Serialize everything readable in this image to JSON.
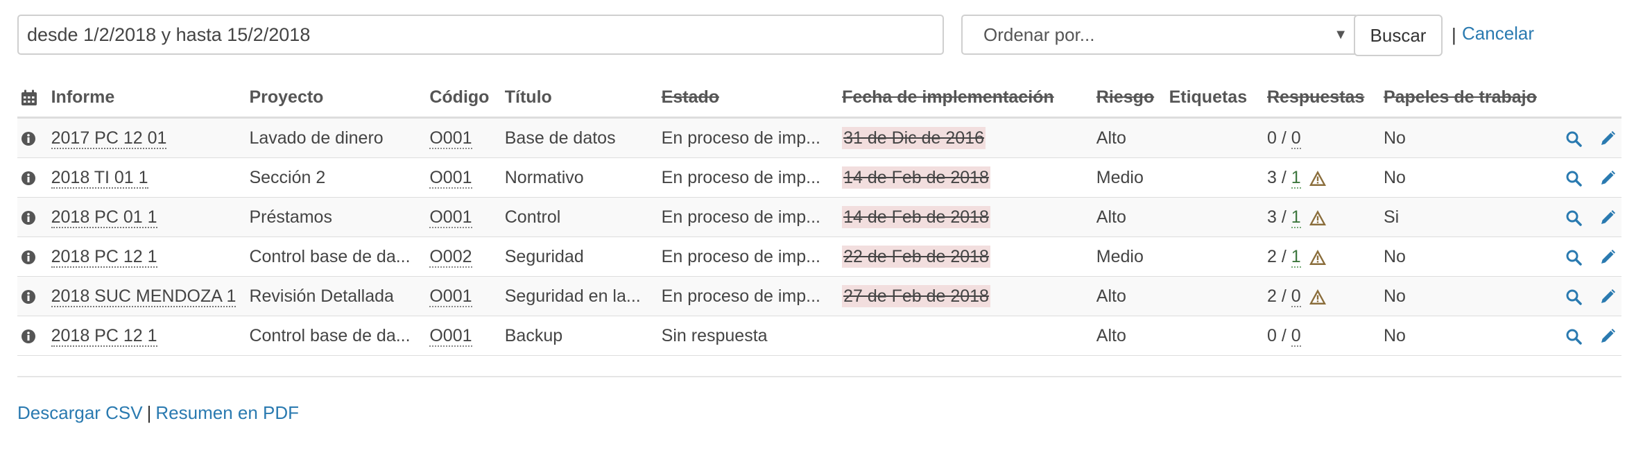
{
  "filter": {
    "query_value": "desde 1/2/2018 y hasta 15/2/2018",
    "order_placeholder": "Ordenar por...",
    "search_label": "Buscar",
    "separator": "|",
    "cancel_label": "Cancelar"
  },
  "table": {
    "headers": {
      "informe": "Informe",
      "proyecto": "Proyecto",
      "codigo": "Código",
      "titulo": "Título",
      "estado": "Estado",
      "fecha": "Fecha de implementación",
      "riesgo": "Riesgo",
      "etiquetas": "Etiquetas",
      "respuestas": "Respuestas",
      "papeles": "Papeles de trabajo"
    },
    "rows": [
      {
        "informe": "2017 PC 12 01",
        "proyecto": "Lavado de dinero",
        "codigo": "O001",
        "titulo": "Base de datos",
        "estado": "En proceso de imp...",
        "fecha": "31 de Dic de 2016",
        "riesgo": "Alto",
        "resp_a": "0",
        "resp_sep": " / ",
        "resp_b": "0",
        "papeles": "No"
      },
      {
        "informe": "2018 TI 01 1",
        "proyecto": "Sección 2",
        "codigo": "O001",
        "titulo": "Normativo",
        "estado": "En proceso de imp...",
        "fecha": "14 de Feb de 2018",
        "riesgo": "Medio",
        "resp_a": "3",
        "resp_sep": " / ",
        "resp_b": "1",
        "papeles": "No"
      },
      {
        "informe": "2018 PC 01 1",
        "proyecto": "Préstamos",
        "codigo": "O001",
        "titulo": "Control",
        "estado": "En proceso de imp...",
        "fecha": "14 de Feb de 2018",
        "riesgo": "Alto",
        "resp_a": "3",
        "resp_sep": " / ",
        "resp_b": "1",
        "papeles": "Si"
      },
      {
        "informe": "2018 PC 12 1",
        "proyecto": "Control base de da...",
        "codigo": "O002",
        "titulo": "Seguridad",
        "estado": "En proceso de imp...",
        "fecha": "22 de Feb de 2018",
        "riesgo": "Medio",
        "resp_a": "2",
        "resp_sep": " / ",
        "resp_b": "1",
        "papeles": "No"
      },
      {
        "informe": "2018 SUC MENDOZA 1",
        "proyecto": "Revisión Detallada",
        "codigo": "O001",
        "titulo": "Seguridad en la...",
        "estado": "En proceso de imp...",
        "fecha": "27 de Feb de 2018",
        "riesgo": "Alto",
        "resp_a": "2",
        "resp_sep": " / ",
        "resp_b": "0",
        "papeles": "No"
      },
      {
        "informe": "2018 PC 12 1",
        "proyecto": "Control base de da...",
        "codigo": "O001",
        "titulo": "Backup",
        "estado": "Sin respuesta",
        "fecha": "",
        "riesgo": "Alto",
        "resp_a": "0",
        "resp_sep": " / ",
        "resp_b": "0",
        "papeles": "No"
      }
    ]
  },
  "footer": {
    "csv_label": "Descargar CSV",
    "separator": "|",
    "pdf_label": "Resumen en PDF"
  },
  "colors": {
    "link": "#2a7ab0",
    "date_overdue_bg": "#f2dede",
    "warning": "#8a6d3b",
    "icon_blue": "#2a7ab0"
  },
  "icons": {
    "info": "info-circle-icon",
    "calendar": "calendar-icon",
    "warning": "warning-triangle-icon",
    "search": "search-icon",
    "edit": "pencil-icon"
  }
}
